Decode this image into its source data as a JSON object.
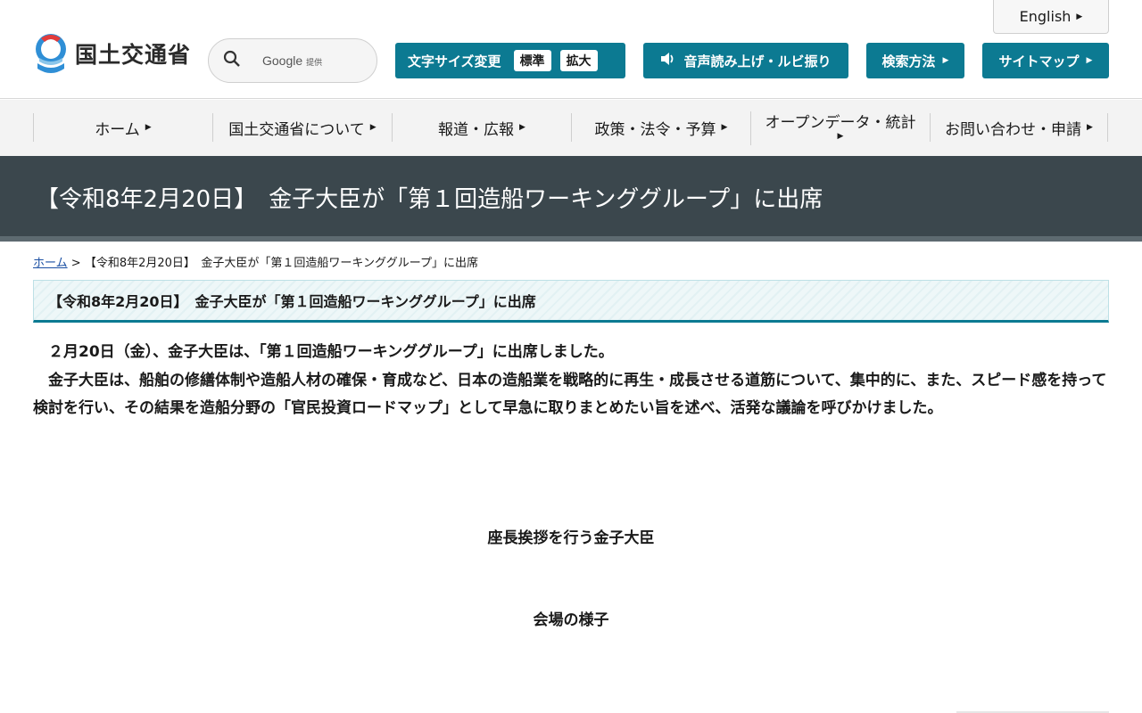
{
  "header": {
    "english_label": "English",
    "logo_text": "国土交通省",
    "search": {
      "provider_label": "Google",
      "provider_suffix": "提供"
    },
    "font_size": {
      "label": "文字サイズ変更",
      "options": [
        "標準",
        "拡大"
      ]
    },
    "voice_label": "音声読み上げ・ルビ振り",
    "search_method_label": "検索方法",
    "sitemap_label": "サイトマップ"
  },
  "nav": {
    "items": [
      {
        "label": "ホーム"
      },
      {
        "label": "国土交通省について"
      },
      {
        "label": "報道・広報"
      },
      {
        "label": "政策・法令・予算"
      },
      {
        "label": "オープンデータ・統計"
      },
      {
        "label": "お問い合わせ・申請"
      }
    ]
  },
  "page": {
    "title": "【令和8年2月20日】　金子大臣が「第１回造船ワーキンググループ」に出席",
    "breadcrumb": {
      "home": "ホーム",
      "separator": ">",
      "current": "【令和8年2月20日】　金子大臣が「第１回造船ワーキンググループ」に出席"
    },
    "section_heading": "【令和8年2月20日】　金子大臣が「第１回造船ワーキンググループ」に出席",
    "paragraphs": [
      "　２月20日（金）、金子大臣は、「第１回造船ワーキンググループ」に出席しました。",
      "　金子大臣は、船舶の修繕体制や造船人材の確保・育成など、日本の造船業を戦略的に再生・成長させる道筋について、集中的に、また、スピード感を持って検討を行い、その結果を造船分野の「官民投資ロードマップ」として早急に取りまとめたい旨を述べ、活発な議論を呼びかけました。"
    ],
    "captions": [
      "座長挨拶を行う金子大臣",
      "会場の様子"
    ]
  },
  "colors": {
    "accent": "#0c7a92",
    "title_band": "#3b474d",
    "link": "#1a4fa3"
  }
}
